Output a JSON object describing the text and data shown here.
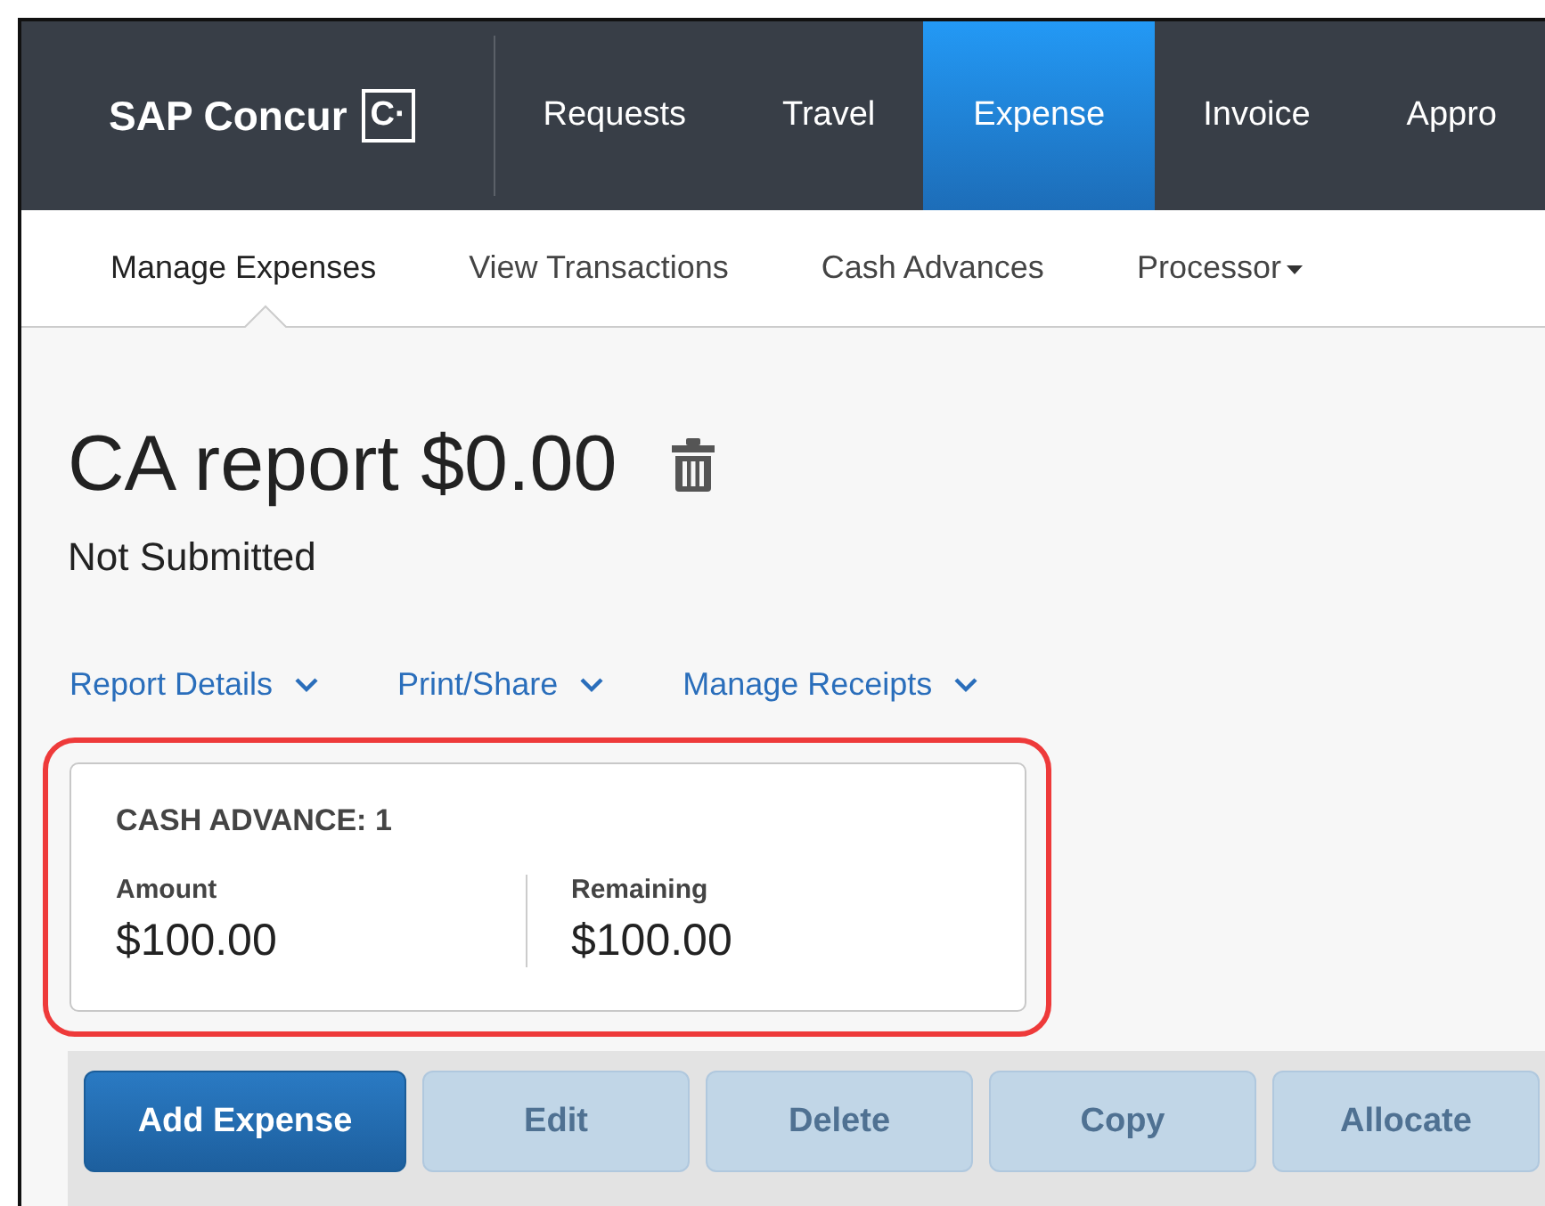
{
  "brand": {
    "name": "SAP Concur",
    "mark": "C·"
  },
  "nav": [
    {
      "label": "Requests",
      "selected": false
    },
    {
      "label": "Travel",
      "selected": false
    },
    {
      "label": "Expense",
      "selected": true
    },
    {
      "label": "Invoice",
      "selected": false
    },
    {
      "label": "Appro",
      "selected": false
    }
  ],
  "subnav": [
    {
      "label": "Manage Expenses",
      "selected": true,
      "dropdown": false
    },
    {
      "label": "View Transactions",
      "selected": false,
      "dropdown": false
    },
    {
      "label": "Cash Advances",
      "selected": false,
      "dropdown": false
    },
    {
      "label": "Processor",
      "selected": false,
      "dropdown": true
    }
  ],
  "report": {
    "title": "CA report $0.00",
    "status": "Not Submitted"
  },
  "links": [
    "Report Details",
    "Print/Share",
    "Manage Receipts"
  ],
  "cash_advance": {
    "highlighted": true,
    "heading": "CASH ADVANCE: 1",
    "fields": [
      {
        "label": "Amount",
        "value": "$100.00"
      },
      {
        "label": "Remaining",
        "value": "$100.00"
      }
    ]
  },
  "buttons": [
    {
      "label": "Add Expense",
      "disabled": false
    },
    {
      "label": "Edit",
      "disabled": true
    },
    {
      "label": "Delete",
      "disabled": true
    },
    {
      "label": "Copy",
      "disabled": true
    },
    {
      "label": "Allocate",
      "disabled": true
    }
  ]
}
